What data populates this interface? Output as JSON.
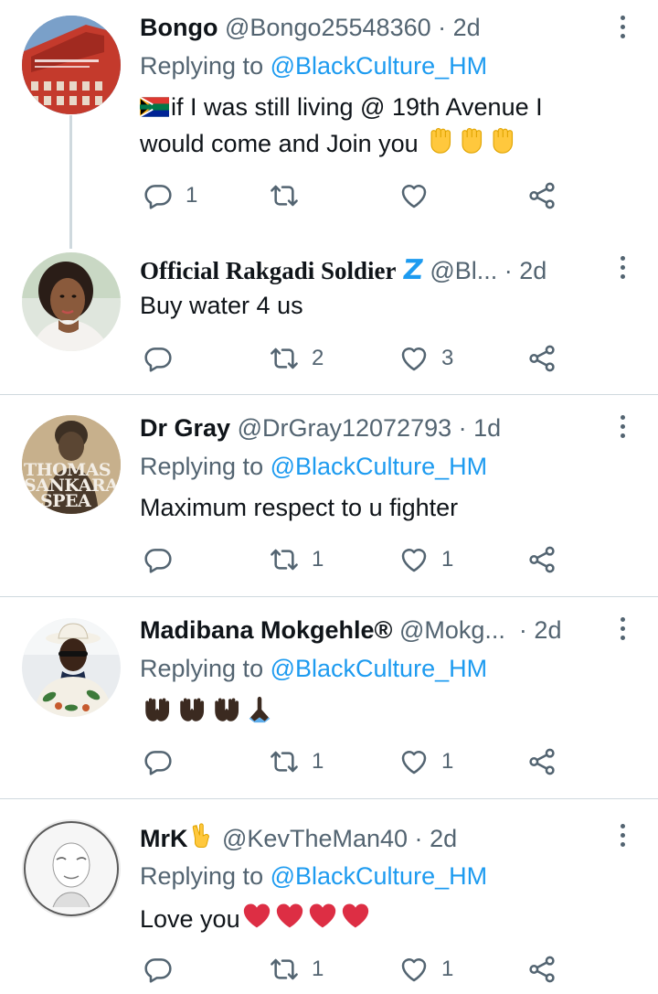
{
  "tweets": [
    {
      "name": "Bongo",
      "handle": "@Bongo25548360",
      "time": "2d",
      "replying_label": "Replying to",
      "replying_to": "@BlackCulture_HM",
      "text_line1": "if I was still living @ 19th Avenue I",
      "text_line2": "would come and Join you",
      "counts": {
        "reply": "1",
        "retweet": "",
        "like": ""
      }
    },
    {
      "name": "Official Rakgadi Soldier",
      "handle": "@Bl...",
      "time": "2d",
      "text": "Buy water 4 us",
      "counts": {
        "reply": "",
        "retweet": "2",
        "like": "3"
      }
    },
    {
      "name": "Dr Gray",
      "handle": "@DrGray12072793",
      "time": "1d",
      "replying_label": "Replying to",
      "replying_to": "@BlackCulture_HM",
      "text": "Maximum respect to u fighter",
      "avatar_text": [
        "THOMAS",
        "SANKARA",
        "SPEA"
      ],
      "counts": {
        "reply": "",
        "retweet": "1",
        "like": "1"
      }
    },
    {
      "name": "Madibana Mokgehle®",
      "handle": "@Mokg...",
      "time": "2d",
      "replying_label": "Replying to",
      "replying_to": "@BlackCulture_HM",
      "counts": {
        "reply": "",
        "retweet": "1",
        "like": "1"
      }
    },
    {
      "name": "MrK",
      "handle": "@KevTheMan40",
      "time": "2d",
      "replying_label": "Replying to",
      "replying_to": "@BlackCulture_HM",
      "text": "Love you",
      "counts": {
        "reply": "",
        "retweet": "1",
        "like": "1"
      }
    }
  ],
  "colors": {
    "accent": "#1d9bf0",
    "muted": "#536471",
    "divider": "#cfd9de",
    "text": "#0f1419"
  },
  "icons": [
    "reply-icon",
    "retweet-icon",
    "like-icon",
    "share-icon",
    "more-icon"
  ]
}
